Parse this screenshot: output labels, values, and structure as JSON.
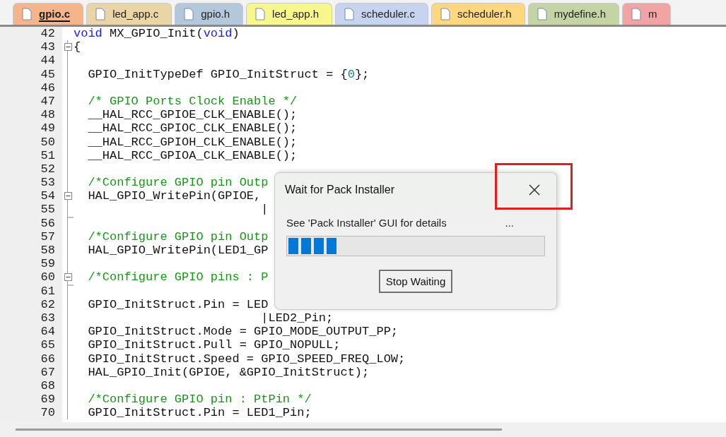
{
  "tabs": [
    {
      "label": "gpio.c",
      "color": "#f6b48a",
      "selected": true
    },
    {
      "label": "led_app.c",
      "color": "#ead5a6",
      "selected": false
    },
    {
      "label": "gpio.h",
      "color": "#b3c8db",
      "selected": false
    },
    {
      "label": "led_app.h",
      "color": "#f8f78c",
      "selected": false
    },
    {
      "label": "scheduler.c",
      "color": "#c7d4ef",
      "selected": false
    },
    {
      "label": "scheduler.h",
      "color": "#fed77f",
      "selected": false
    },
    {
      "label": "mydefine.h",
      "color": "#c4d4a4",
      "selected": false
    },
    {
      "label": "m",
      "color": "#f2a3a3",
      "selected": false
    }
  ],
  "editor": {
    "lines": [
      {
        "number": "42",
        "collapse_box": false,
        "fold_end": false,
        "segments": [
          {
            "text": "void",
            "kind": "keyword"
          },
          {
            "text": " MX_GPIO_Init(",
            "kind": "plain"
          },
          {
            "text": "void",
            "kind": "keyword"
          },
          {
            "text": ")",
            "kind": "plain"
          }
        ]
      },
      {
        "number": "43",
        "collapse_box": true,
        "fold_end": false,
        "segments": [
          {
            "text": "{",
            "kind": "plain"
          }
        ]
      },
      {
        "number": "44",
        "collapse_box": false,
        "fold_end": false
      },
      {
        "number": "45",
        "collapse_box": false,
        "fold_end": false,
        "segments": [
          {
            "text": "  GPIO_InitTypeDef GPIO_InitStruct = {",
            "kind": "plain"
          },
          {
            "text": "0",
            "kind": "number"
          },
          {
            "text": "};",
            "kind": "plain"
          }
        ]
      },
      {
        "number": "46",
        "collapse_box": false,
        "fold_end": false
      },
      {
        "number": "47",
        "collapse_box": false,
        "fold_end": false,
        "segments": [
          {
            "text": "  /* GPIO Ports Clock Enable */",
            "kind": "comment"
          }
        ]
      },
      {
        "number": "48",
        "collapse_box": false,
        "fold_end": false,
        "segments": [
          {
            "text": "  __HAL_RCC_GPIOE_CLK_ENABLE();",
            "kind": "plain"
          }
        ]
      },
      {
        "number": "49",
        "collapse_box": false,
        "fold_end": false,
        "segments": [
          {
            "text": "  __HAL_RCC_GPIOC_CLK_ENABLE();",
            "kind": "plain"
          }
        ]
      },
      {
        "number": "50",
        "collapse_box": false,
        "fold_end": false,
        "segments": [
          {
            "text": "  __HAL_RCC_GPIOH_CLK_ENABLE();",
            "kind": "plain"
          }
        ]
      },
      {
        "number": "51",
        "collapse_box": false,
        "fold_end": false,
        "segments": [
          {
            "text": "  __HAL_RCC_GPIOA_CLK_ENABLE();",
            "kind": "plain"
          }
        ]
      },
      {
        "number": "52",
        "collapse_box": false,
        "fold_end": false
      },
      {
        "number": "53",
        "collapse_box": false,
        "fold_end": false,
        "segments": [
          {
            "text": "  /*Configure GPIO pin Outp",
            "kind": "comment"
          }
        ]
      },
      {
        "number": "54",
        "collapse_box": true,
        "fold_end": false,
        "segments": [
          {
            "text": "  HAL_GPIO_WritePin(GPIOE,",
            "kind": "plain"
          }
        ]
      },
      {
        "number": "55",
        "collapse_box": false,
        "fold_end": false,
        "segments": [
          {
            "text": "                          |",
            "kind": "plain"
          }
        ]
      },
      {
        "number": "56",
        "collapse_box": false,
        "fold_end": true
      },
      {
        "number": "57",
        "collapse_box": false,
        "fold_end": false,
        "segments": [
          {
            "text": "  /*Configure GPIO pin Outp",
            "kind": "comment"
          }
        ]
      },
      {
        "number": "58",
        "collapse_box": false,
        "fold_end": false,
        "segments": [
          {
            "text": "  HAL_GPIO_WritePin(LED1_GP",
            "kind": "plain"
          }
        ]
      },
      {
        "number": "59",
        "collapse_box": false,
        "fold_end": false
      },
      {
        "number": "60",
        "collapse_box": true,
        "fold_end": false,
        "segments": [
          {
            "text": "  /*Configure GPIO pins : P",
            "kind": "comment"
          }
        ]
      },
      {
        "number": "61",
        "collapse_box": false,
        "fold_end": true
      },
      {
        "number": "62",
        "collapse_box": false,
        "fold_end": false,
        "segments": [
          {
            "text": "  GPIO_InitStruct.Pin = LED",
            "kind": "plain"
          }
        ]
      },
      {
        "number": "63",
        "collapse_box": false,
        "fold_end": false,
        "segments": [
          {
            "text": "                          |LED2_Pin;",
            "kind": "plain"
          }
        ]
      },
      {
        "number": "64",
        "collapse_box": false,
        "fold_end": false,
        "segments": [
          {
            "text": "  GPIO_InitStruct.Mode = GPIO_MODE_OUTPUT_PP;",
            "kind": "plain"
          }
        ]
      },
      {
        "number": "65",
        "collapse_box": false,
        "fold_end": false,
        "segments": [
          {
            "text": "  GPIO_InitStruct.Pull = GPIO_NOPULL;",
            "kind": "plain"
          }
        ]
      },
      {
        "number": "66",
        "collapse_box": false,
        "fold_end": false,
        "segments": [
          {
            "text": "  GPIO_InitStruct.Speed = GPIO_SPEED_FREQ_LOW;",
            "kind": "plain"
          }
        ]
      },
      {
        "number": "67",
        "collapse_box": false,
        "fold_end": false,
        "segments": [
          {
            "text": "  HAL_GPIO_Init(GPIOE, &GPIO_InitStruct);",
            "kind": "plain"
          }
        ]
      },
      {
        "number": "68",
        "collapse_box": false,
        "fold_end": false
      },
      {
        "number": "69",
        "collapse_box": false,
        "fold_end": false,
        "segments": [
          {
            "text": "  /*Configure GPIO pin : PtPin */",
            "kind": "comment"
          }
        ]
      },
      {
        "number": "70",
        "collapse_box": false,
        "fold_end": false,
        "segments": [
          {
            "text": "  GPIO_InitStruct.Pin = LED1_Pin;",
            "kind": "plain"
          }
        ]
      }
    ]
  },
  "dialog": {
    "title": "Wait for Pack Installer",
    "message": "See 'Pack Installer' GUI for details",
    "ellipsis": "...",
    "progress": {
      "level": 0.2
    },
    "button": "Stop Waiting"
  }
}
